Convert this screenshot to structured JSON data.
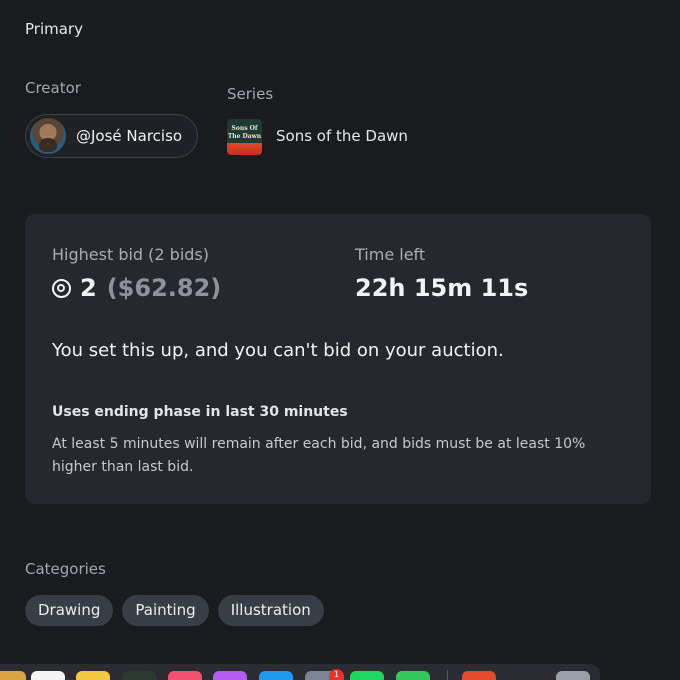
{
  "primary_label": "Primary",
  "creator": {
    "label": "Creator",
    "name": "@José Narciso"
  },
  "series": {
    "label": "Series",
    "thumb_text": "Sons Of The Dawn",
    "name": "Sons of the Dawn"
  },
  "bid": {
    "highest_label": "Highest bid (2 bids)",
    "amount": "2",
    "fiat": "($62.82)",
    "time_label": "Time left",
    "time_value": "22h 15m 11s",
    "notice": "You set this up, and you can't bid on your auction.",
    "phase_title": "Uses ending phase in last 30 minutes",
    "phase_desc": "At least 5 minutes will remain after each bid, and bids must be at least 10% higher than last bid."
  },
  "categories": {
    "label": "Categories",
    "items": [
      "Drawing",
      "Painting",
      "Illustration"
    ]
  },
  "dock": {
    "badge": "1",
    "icons": [
      {
        "name": "finder-icon",
        "color": "#d9a441"
      },
      {
        "name": "calendar-icon",
        "color": "#f4f4f4"
      },
      {
        "name": "notes-icon",
        "color": "#f5c842"
      },
      {
        "name": "terminal-icon",
        "color": "#2d3a33"
      },
      {
        "name": "music-icon",
        "color": "#f0506e"
      },
      {
        "name": "podcasts-icon",
        "color": "#b45cf2"
      },
      {
        "name": "appstore-icon",
        "color": "#1e9bf0"
      },
      {
        "name": "mail-icon",
        "color": "#7c8596"
      },
      {
        "name": "spotify-icon",
        "color": "#1ed760"
      },
      {
        "name": "messages-icon",
        "color": "#34c759"
      },
      {
        "name": "preview-icon",
        "color": "#e34a2c"
      },
      {
        "name": "trash-icon",
        "color": "#9aa0a8"
      }
    ]
  }
}
